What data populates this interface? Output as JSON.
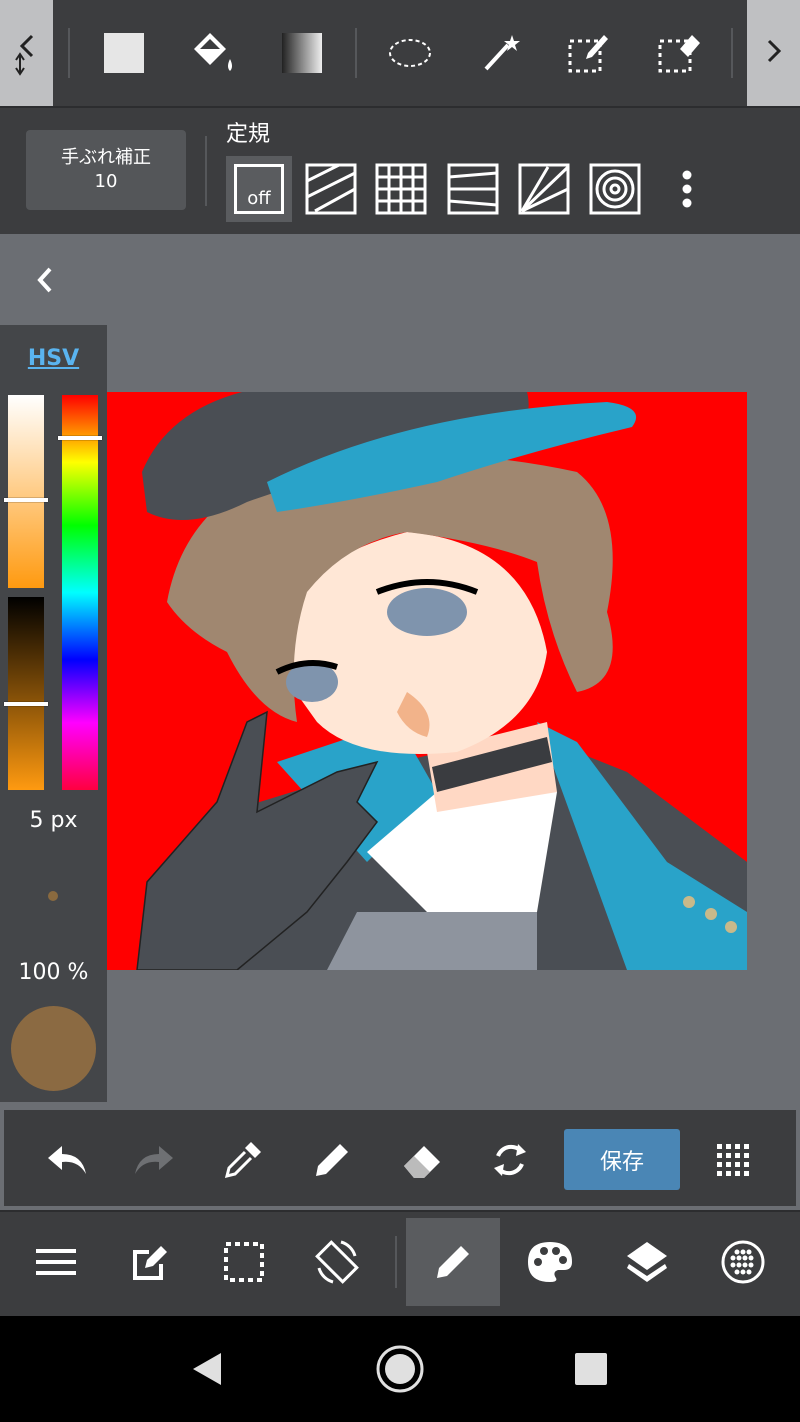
{
  "top_toolbar": {
    "tools": [
      "rectangle-fill-tool",
      "bucket-fill-tool",
      "gradient-tool",
      "lasso-select-tool",
      "magic-wand-tool",
      "select-pen-tool",
      "select-eraser-tool"
    ],
    "left_arrow_icon": "chevron-left-icon",
    "right_arrow_icon": "chevron-right-icon"
  },
  "second_bar": {
    "stabilizer_label": "手ぶれ補正",
    "stabilizer_value": "10",
    "ruler_label": "定規",
    "ruler_off_label": "off",
    "rulers": [
      "ruler-off",
      "ruler-parallel",
      "ruler-grid",
      "ruler-perspective-parallel",
      "ruler-radial",
      "ruler-concentric",
      "more-options"
    ]
  },
  "color_panel": {
    "mode_label": "HSV",
    "brush_size": "5 px",
    "opacity": "100 %",
    "current_color": "#8b6a42",
    "saturation_level": 0.55,
    "value_level": 0.55,
    "hue_level": 0.11
  },
  "action_bar": {
    "tools": [
      "undo",
      "redo",
      "eyedropper",
      "pen",
      "eraser",
      "transform-flip"
    ],
    "save_label": "保存"
  },
  "bottom_bar": {
    "items": [
      "menu",
      "edit",
      "selection",
      "rotate-canvas",
      "brush",
      "palette",
      "layers",
      "material"
    ]
  },
  "colors": {
    "toolbar_bg": "#3c3d3f",
    "canvas_bg": "#6b6e73",
    "artwork_bg": "#ff0000",
    "save_button": "#4a86b5",
    "hsv_link": "#5ab4f0"
  }
}
